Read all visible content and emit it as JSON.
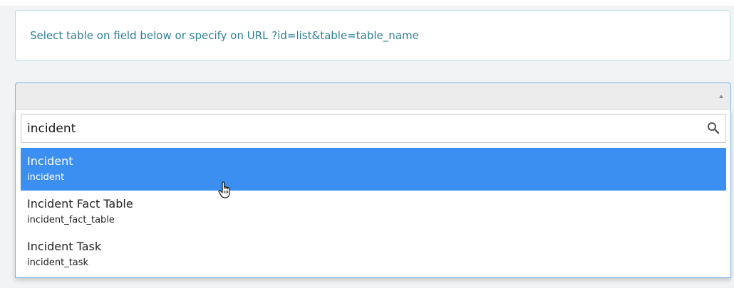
{
  "info": {
    "message": "Select table on field below or specify on URL ?id=list&table=table_name"
  },
  "select": {
    "selected_value": "",
    "arrow_icon": "caret-up-icon"
  },
  "search": {
    "value": "incident",
    "icon": "search-icon"
  },
  "options": [
    {
      "label": "Incident",
      "name": "incident",
      "selected": true
    },
    {
      "label": "Incident Fact Table",
      "name": "incident_fact_table",
      "selected": false
    },
    {
      "label": "Incident Task",
      "name": "incident_task",
      "selected": false
    }
  ],
  "colors": {
    "info_text": "#2e7f95",
    "info_border": "#b6dde3",
    "highlight": "#3a8ff0",
    "select_border": "#7fb5e6",
    "page_background": "#f1f3f4"
  },
  "cursor": {
    "icon": "hand-pointer-icon"
  }
}
